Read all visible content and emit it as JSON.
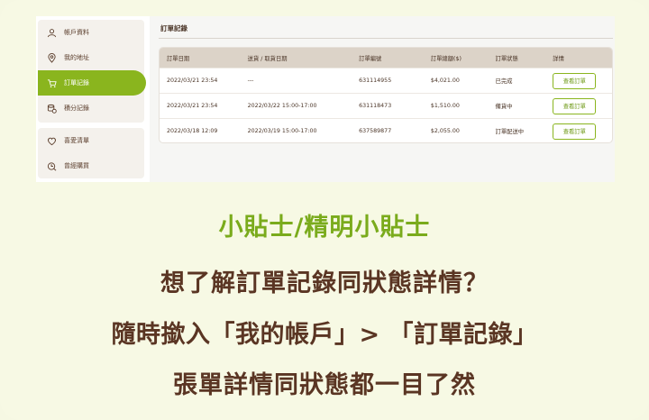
{
  "sidebar": {
    "items": [
      {
        "label": "帳戶資料",
        "icon": "user-icon"
      },
      {
        "label": "我的地址",
        "icon": "location-pin-icon"
      },
      {
        "label": "訂單記錄",
        "icon": "cart-icon",
        "active": true
      },
      {
        "label": "積分記錄",
        "icon": "coins-icon"
      },
      {
        "label": "喜愛清單",
        "icon": "heart-icon"
      },
      {
        "label": "曾經購買",
        "icon": "bag-icon"
      }
    ]
  },
  "main": {
    "title": "訂單記錄",
    "columns": [
      "訂單日期",
      "送貨 / 取貨日期",
      "訂單編號",
      "訂單總額($)",
      "訂單狀態",
      "詳情"
    ],
    "rows": [
      {
        "date": "2022/03/21 23:54",
        "delivery": "---",
        "order_no": "631114955",
        "total": "$4,021.00",
        "status": "已完成",
        "action": "查看訂單"
      },
      {
        "date": "2022/03/21 23:54",
        "delivery": "2022/03/22 15:00-17:00",
        "order_no": "631118473",
        "total": "$1,510.00",
        "status": "備貨中",
        "action": "查看訂單"
      },
      {
        "date": "2022/03/18 12:09",
        "delivery": "2022/03/19 15:00-17:00",
        "order_no": "637589877",
        "total": "$2,055.00",
        "status": "訂單配送中",
        "action": "查看訂單"
      }
    ]
  },
  "tip": {
    "title": "小貼士/精明小貼士",
    "line1": "想了解訂單記錄同狀態詳情？",
    "line2": "隨時撳入「我的帳戶」> 「訂單記錄」",
    "line3": "張單詳情同狀態都一目了然"
  },
  "colors": {
    "accent": "#8ab51e",
    "heading": "#7aab1c",
    "text": "#5a3523",
    "background": "#f7f9e4"
  }
}
